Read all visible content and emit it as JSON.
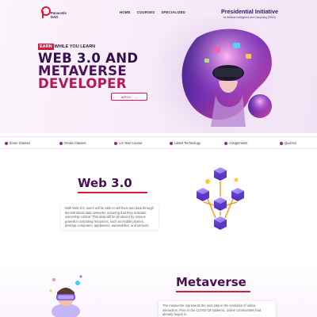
{
  "brand": {
    "logo_line1": "Panacotie",
    "logo_line2": "DAO",
    "accent": "#d81b3c",
    "primary": "#4a1052"
  },
  "nav": {
    "items": [
      "HOME",
      "COURSES",
      "SPECIALIZED"
    ]
  },
  "initiative": {
    "title": "Presidential Initiative",
    "subtitle": "for Artificial Intelligence and Computing (PIAIC)"
  },
  "hero": {
    "earn_badge": "EARN",
    "earn_rest": "WHILE YOU LEARN",
    "title_line1": "WEB 3.0 AND",
    "title_line2": "METAVERSE",
    "title_line3": "DEVELOPER",
    "apply_label": "APPLY",
    "apply_arrow": "→"
  },
  "features": [
    {
      "label": "Zoom Classes",
      "icon": "video-icon"
    },
    {
      "label": "Onsite Classes",
      "icon": "building-icon"
    },
    {
      "label": "1.5 Year Course",
      "icon": "calendar-icon"
    },
    {
      "label": "Latest Technology",
      "icon": "chip-icon"
    },
    {
      "label": "Assignments",
      "icon": "clipboard-icon"
    },
    {
      "label": "Quizzes",
      "icon": "quiz-icon"
    }
  ],
  "web3": {
    "title": "Web 3.0",
    "body": "With Web 3.0, users will be able to sell their own data through decentralized data networks, ensuring that they maintain ownership control. This data will be produced by various powerful computing resources, such as mobile phones, desktop computers, appliances, automobiles, and sensors."
  },
  "metaverse": {
    "title": "Metaverse",
    "body": "The metaverse represents the next step in the evolution of online interaction. Prior to the COVID-19 epidemic, online communities had already begun to"
  }
}
